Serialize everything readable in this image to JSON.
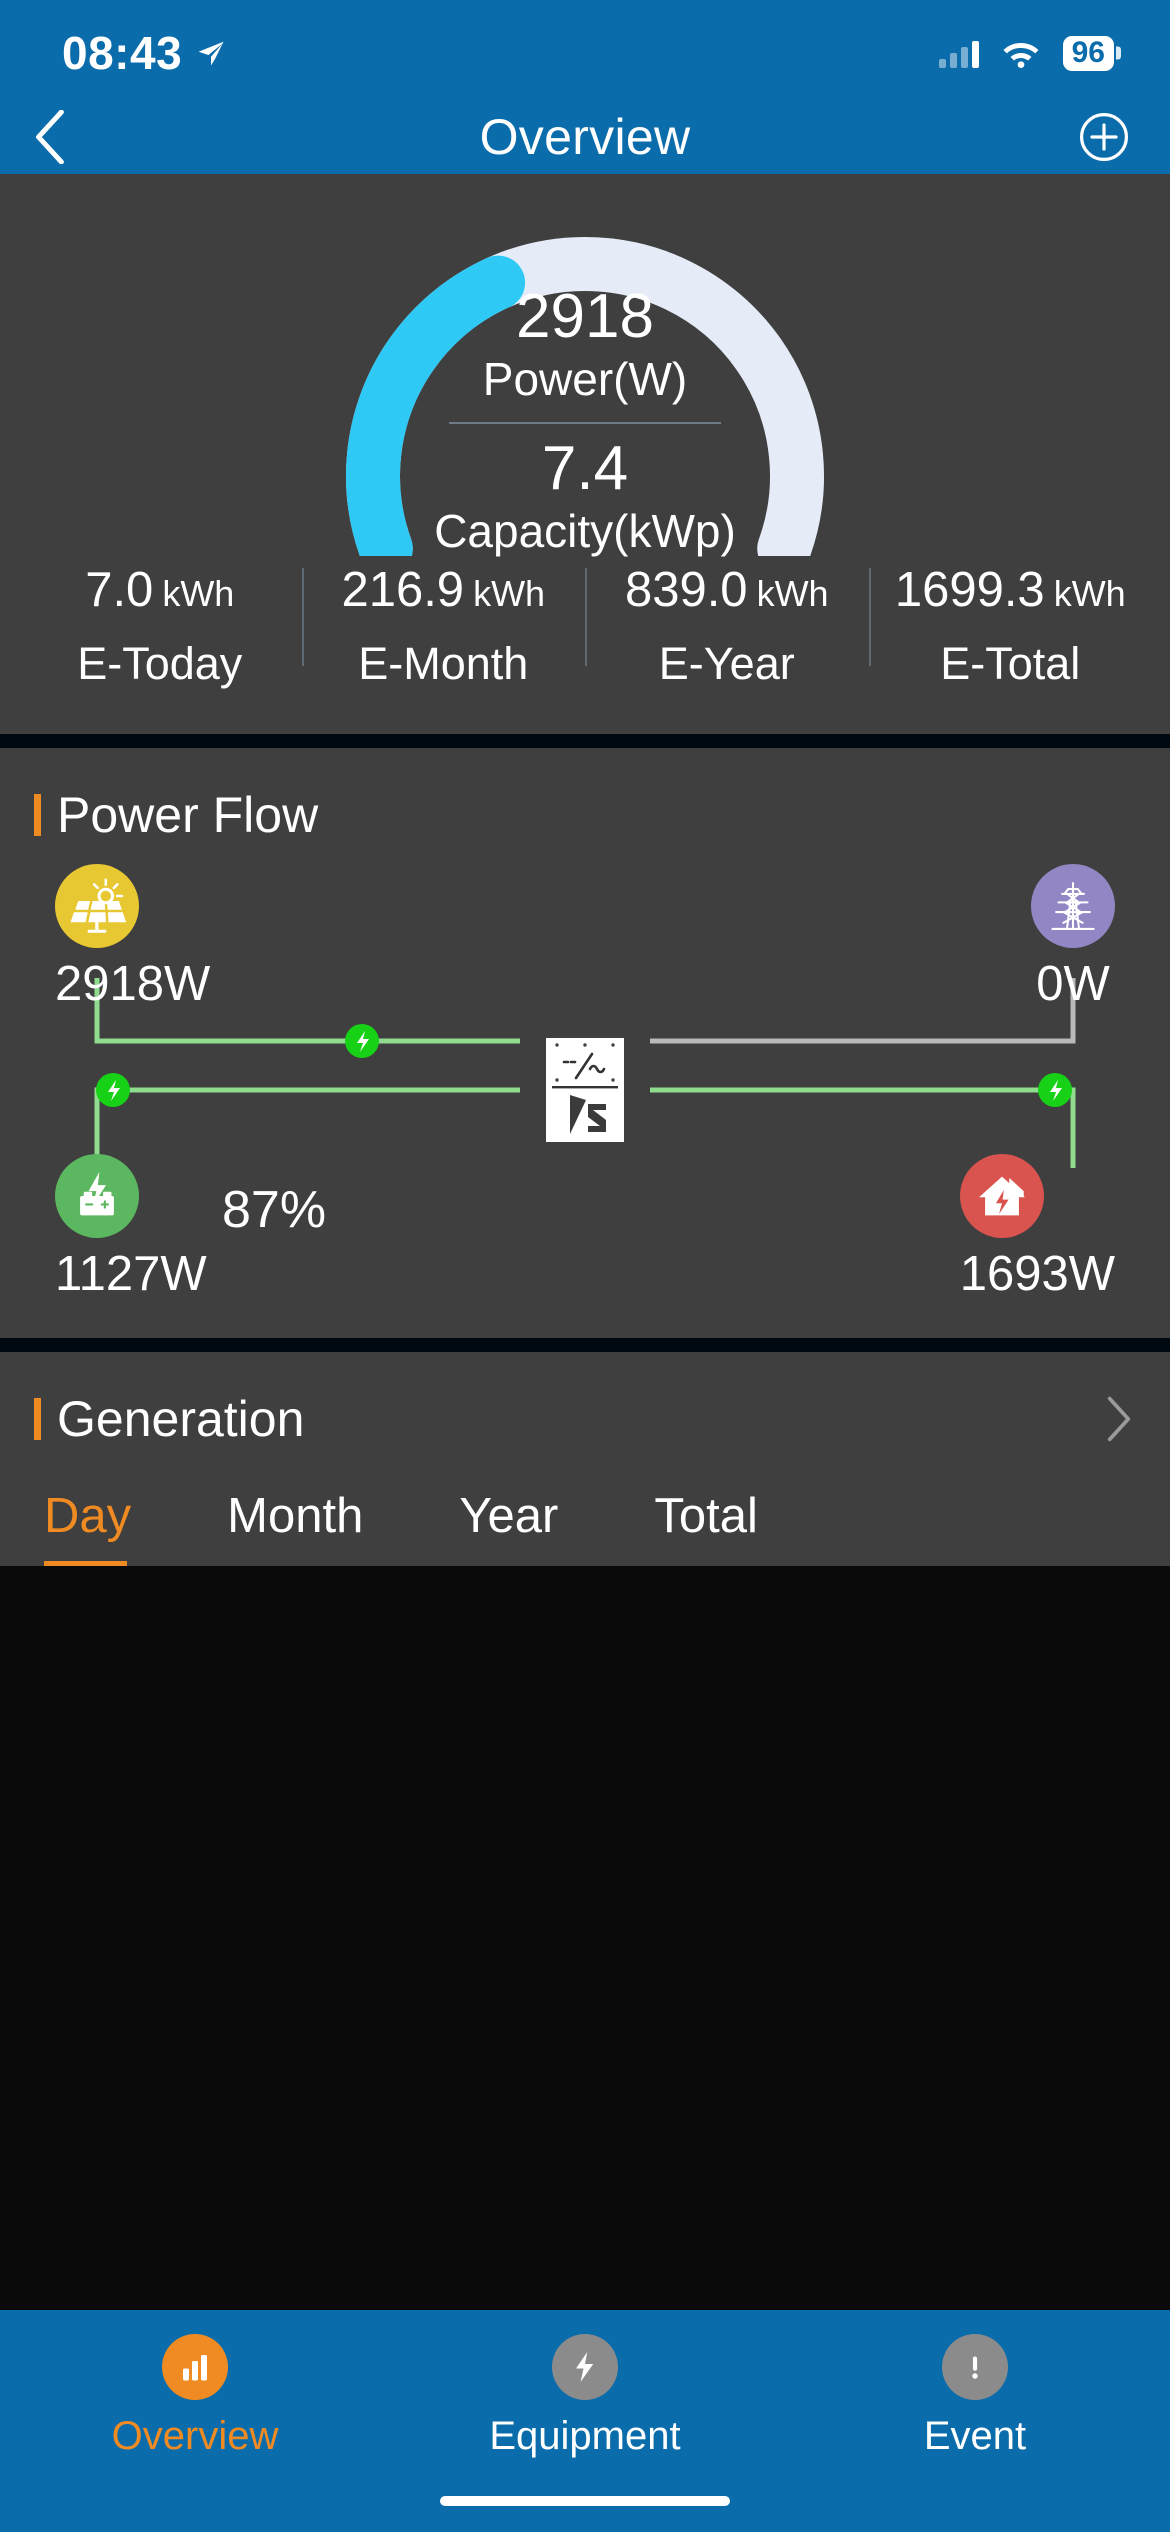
{
  "status_bar": {
    "time": "08:43",
    "location_icon": "location-arrow-icon",
    "signal_icon": "cellular-bars-icon",
    "wifi_icon": "wifi-icon",
    "battery_level": "96"
  },
  "nav": {
    "back_icon": "chevron-left-icon",
    "title": "Overview",
    "add_icon": "plus-circle-icon"
  },
  "gauge": {
    "power_value": "2918",
    "power_label": "Power(W)",
    "capacity_value": "7.4",
    "capacity_label": "Capacity(kWp)",
    "arc_color": "#2fc9f5",
    "track_color": "#e6ecf7",
    "percent": 39
  },
  "stats": [
    {
      "value": "7.0",
      "unit": "kWh",
      "name": "E-Today"
    },
    {
      "value": "216.9",
      "unit": "kWh",
      "name": "E-Month"
    },
    {
      "value": "839.0",
      "unit": "kWh",
      "name": "E-Year"
    },
    {
      "value": "1699.3",
      "unit": "kWh",
      "name": "E-Total"
    }
  ],
  "power_flow": {
    "title": "Power Flow",
    "accent_color": "#ef8b22",
    "nodes": {
      "pv": {
        "icon": "solar-panel-icon",
        "power": "2918W",
        "color": "#e8c832"
      },
      "grid": {
        "icon": "power-tower-icon",
        "power": "0W",
        "color": "#9287c4"
      },
      "battery": {
        "icon": "battery-charging-icon",
        "power": "1127W",
        "soc": "87%",
        "color": "#5cb860"
      },
      "home": {
        "icon": "house-bolt-icon",
        "power": "1693W",
        "color": "#d9534f"
      }
    },
    "inverter": {
      "icon": "inverter-icon",
      "brand_icon": "brand-s-logo-icon"
    },
    "line_active_color": "#8fdc8f",
    "line_idle_color": "#b9b9b9",
    "dot_color": "#17d117"
  },
  "generation": {
    "title": "Generation",
    "chevron_icon": "chevron-right-icon",
    "tabs": [
      {
        "label": "Day",
        "active": true
      },
      {
        "label": "Month",
        "active": false
      },
      {
        "label": "Year",
        "active": false
      },
      {
        "label": "Total",
        "active": false
      }
    ]
  },
  "tabbar": {
    "items": [
      {
        "label": "Overview",
        "icon": "bar-chart-icon",
        "active": true
      },
      {
        "label": "Equipment",
        "icon": "bolt-icon",
        "active": false
      },
      {
        "label": "Event",
        "icon": "alert-icon",
        "active": false
      }
    ],
    "active_color": "#ef8b22"
  }
}
